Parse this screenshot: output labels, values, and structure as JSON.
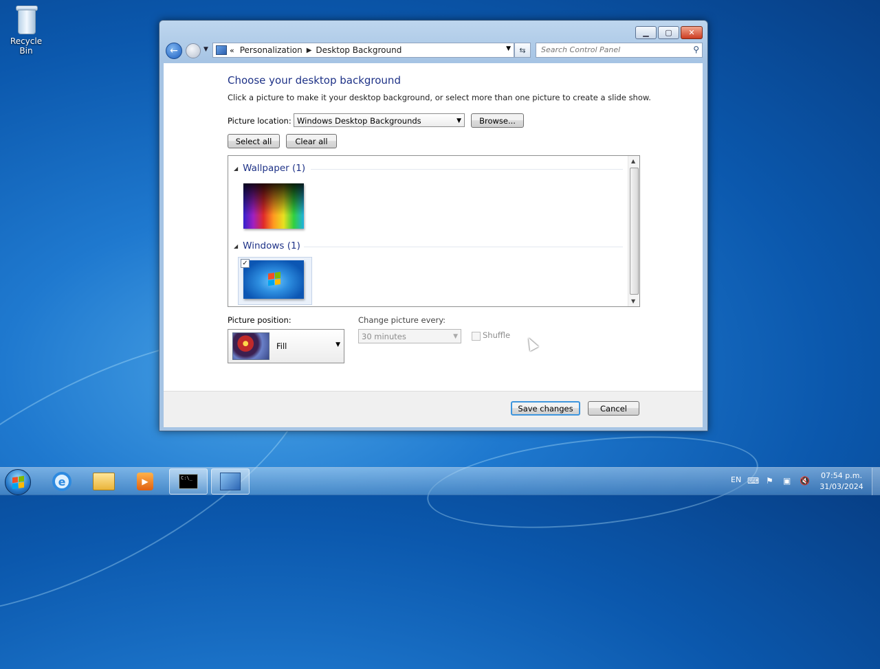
{
  "desktop": {
    "recycle_bin_label": "Recycle Bin"
  },
  "window": {
    "breadcrumb": [
      "Personalization",
      "Desktop Background"
    ],
    "search_placeholder": "Search Control Panel"
  },
  "content": {
    "title": "Choose your desktop background",
    "description": "Click a picture to make it your desktop background, or select more than one picture to create a slide show.",
    "picture_location_label": "Picture location:",
    "picture_location_value": "Windows Desktop Backgrounds",
    "browse_label": "Browse...",
    "select_all_label": "Select all",
    "clear_all_label": "Clear all",
    "groups": [
      {
        "name": "Wallpaper (1)",
        "checked": false
      },
      {
        "name": "Windows (1)",
        "checked": true
      }
    ],
    "picture_position_label": "Picture position:",
    "picture_position_value": "Fill",
    "change_every_label": "Change picture every:",
    "change_every_value": "30 minutes",
    "shuffle_label": "Shuffle",
    "shuffle_checked": false
  },
  "footer": {
    "save_label": "Save changes",
    "cancel_label": "Cancel"
  },
  "taskbar": {
    "language": "EN",
    "time": "07:54 p.m.",
    "date": "31/03/2024",
    "items": [
      "start-orb-icon",
      "internet-explorer-icon",
      "windows-explorer-icon",
      "media-player-icon",
      "command-prompt-icon",
      "control-panel-icon"
    ]
  },
  "colors": {
    "accent_title": "#1e3287",
    "desktop_blue": "#0b58ad",
    "focus_border": "#3d95dd"
  }
}
